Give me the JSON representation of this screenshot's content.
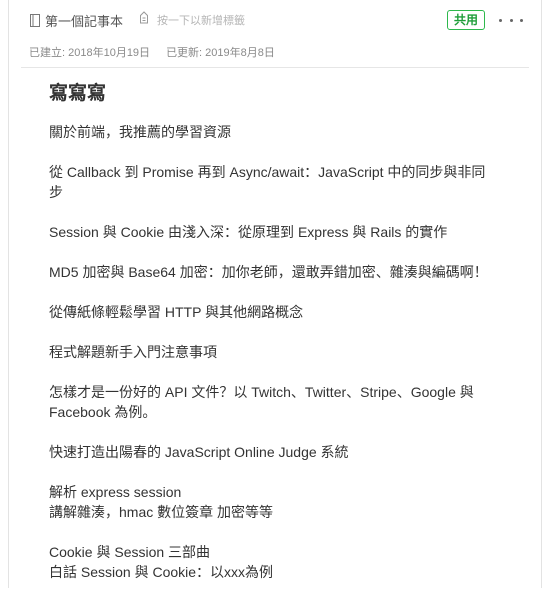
{
  "header": {
    "notebook_name": "第一個記事本",
    "notebook_icon": "notebook-icon",
    "tag_placeholder": "按一下以新增標籤",
    "tag_icon": "tag-icon",
    "share_label": "共用",
    "more_icon": "more-icon"
  },
  "meta": {
    "created": "已建立: 2018年10月19日",
    "updated": "已更新: 2019年8月8日"
  },
  "note": {
    "title": "寫寫寫",
    "paragraphs": [
      [
        "關於前端，我推薦的學習資源"
      ],
      [
        "從 Callback 到 Promise 再到 Async/await：JavaScript 中的同步與非同",
        "步"
      ],
      [
        "Session 與 Cookie 由淺入深：從原理到 Express 與 Rails 的實作"
      ],
      [
        "MD5 加密與 Base64 加密：加你老師，還敢弄錯加密、雜湊與編碼啊！"
      ],
      [
        "從傳紙條輕鬆學習 HTTP 與其他網路概念"
      ],
      [
        "程式解題新手入門注意事項"
      ],
      [
        "怎樣才是一份好的 API 文件？以 Twitch、Twitter、Stripe、Google 與",
        "Facebook 為例。"
      ],
      [
        "快速打造出陽春的 JavaScript Online Judge 系統"
      ],
      [
        "解析 express session",
        "講解雜湊，hmac 數位簽章 加密等等"
      ],
      [
        "Cookie 與 Session 三部曲",
        "白話 Session 與 Cookie：以xxx為例"
      ]
    ]
  }
}
